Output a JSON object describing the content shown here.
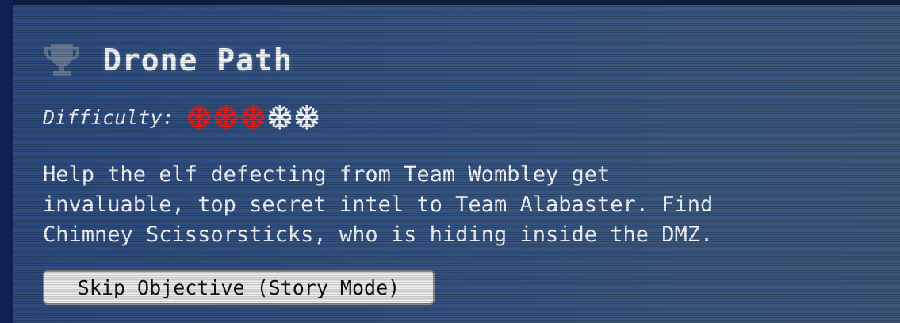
{
  "objective": {
    "title": "Drone Path",
    "trophy_icon": "trophy-icon",
    "difficulty_label": "Difficulty:",
    "difficulty_level": 3,
    "difficulty_max": 5,
    "difficulty_icon": "snowflake-icon",
    "colors": {
      "filled": "#e81b1b",
      "empty": "#f4f6fa"
    },
    "description": "Help the elf defecting from Team Wombley get\ninvaluable, top secret intel to Team Alabaster. Find\nChimney Scissorsticks, who is hiding inside the DMZ.",
    "skip_button_label": "Skip Objective (Story Mode)"
  }
}
